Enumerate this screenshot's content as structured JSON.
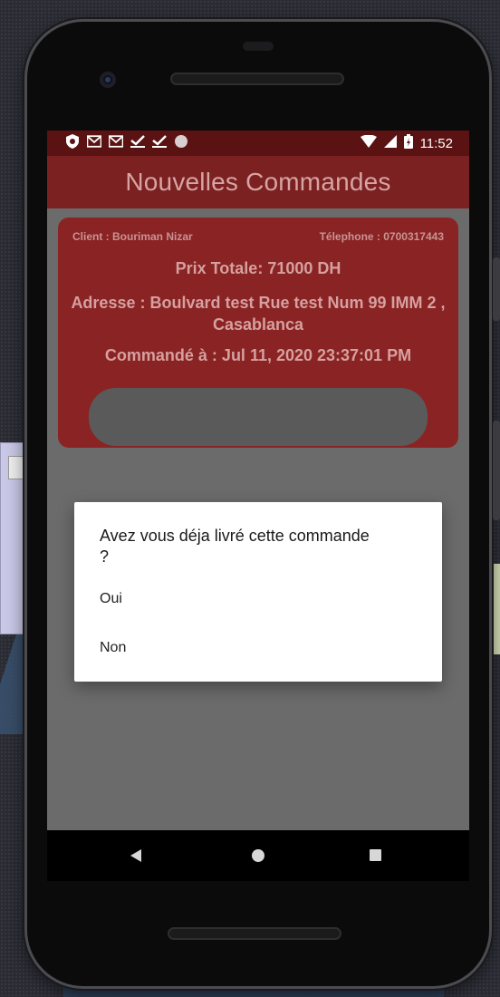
{
  "statusbar": {
    "left_icons": [
      "shield-icon",
      "gmail-icon",
      "gmail-icon",
      "check-icon",
      "check-icon",
      "circle-icon"
    ],
    "time": "11:52"
  },
  "app": {
    "title": "Nouvelles Commandes"
  },
  "order": {
    "client": "Client : Bouriman Nizar",
    "telephone": "Télephone : 0700317443",
    "prix": "Prix Totale: 71000 DH",
    "adresse": "Adresse : Boulvard test Rue test Num 99 IMM 2 , Casablanca",
    "commande": "Commandé à : Jul 11, 2020 23:37:01 PM"
  },
  "dialog": {
    "title": "Avez vous déja livré cette commande ?",
    "options": [
      "Oui",
      "Non"
    ]
  },
  "navbar": {
    "icons": [
      "back-icon",
      "home-icon",
      "recents-icon"
    ]
  },
  "colors": {
    "statusbar": "#5b1212",
    "appbar": "#7b2121",
    "card": "#8a2323",
    "dim": "#6b6b6b"
  }
}
